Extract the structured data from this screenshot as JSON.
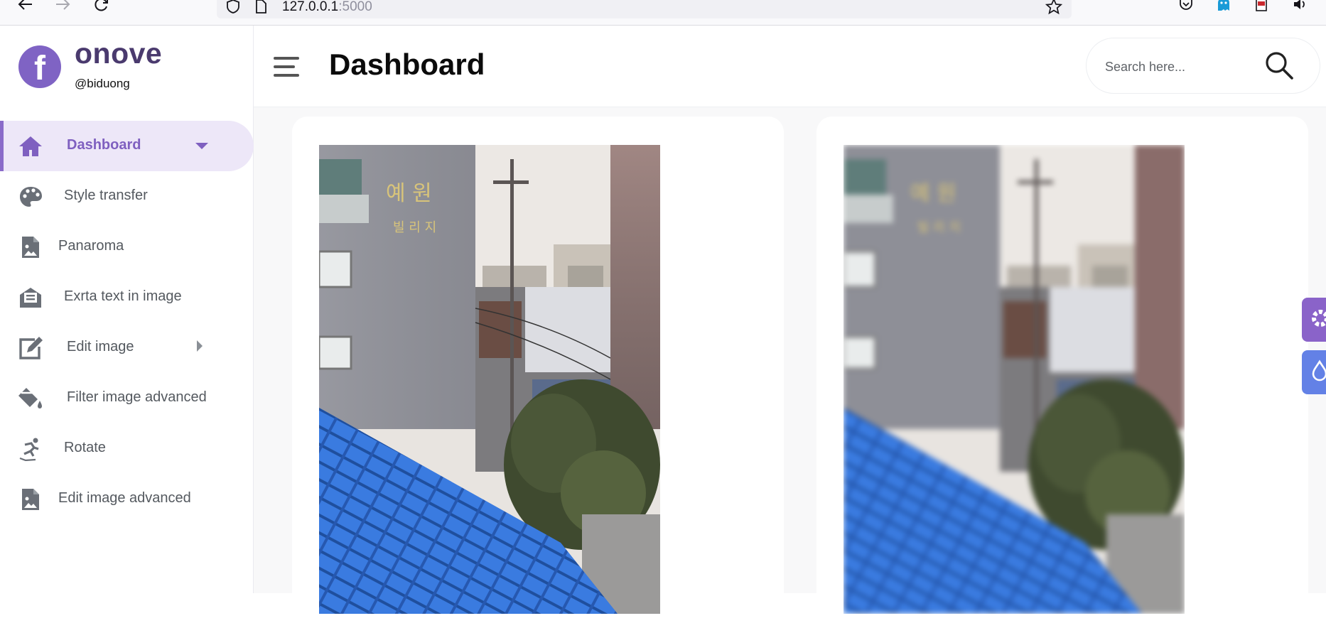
{
  "browser": {
    "url_host": "127.0.0.1",
    "url_port": ":5000"
  },
  "brand": {
    "logo_letter": "f",
    "name": "onove",
    "handle": "@biduong"
  },
  "sidebar": {
    "items": [
      {
        "label": "Dashboard",
        "icon": "home-icon",
        "active": true,
        "submenu": "down"
      },
      {
        "label": "Style transfer",
        "icon": "palette-icon"
      },
      {
        "label": "Panaroma",
        "icon": "image-file-icon"
      },
      {
        "label": "Exrta text in image",
        "icon": "text-envelope-icon"
      },
      {
        "label": "Edit image",
        "icon": "edit-icon",
        "submenu": "right"
      },
      {
        "label": "Filter image advanced",
        "icon": "paint-bucket-icon"
      },
      {
        "label": "Rotate",
        "icon": "skating-icon"
      },
      {
        "label": "Edit image advanced",
        "icon": "image-file-icon"
      }
    ]
  },
  "header": {
    "title": "Dashboard",
    "search_placeholder": "Search here..."
  },
  "images": [
    {
      "name": "original-image",
      "sign_text_top": "예 원",
      "sign_text_bottom": "빌 리 지"
    },
    {
      "name": "blurred-image",
      "sign_text_top": "예 원",
      "sign_text_bottom": "빌 리 지"
    }
  ],
  "colors": {
    "accent": "#7f60c0",
    "active_bg": "#ede7f8",
    "settings_button": "#8a63c9",
    "theme_button": "#6381e6",
    "roof_blue": "#2f6fd4"
  }
}
